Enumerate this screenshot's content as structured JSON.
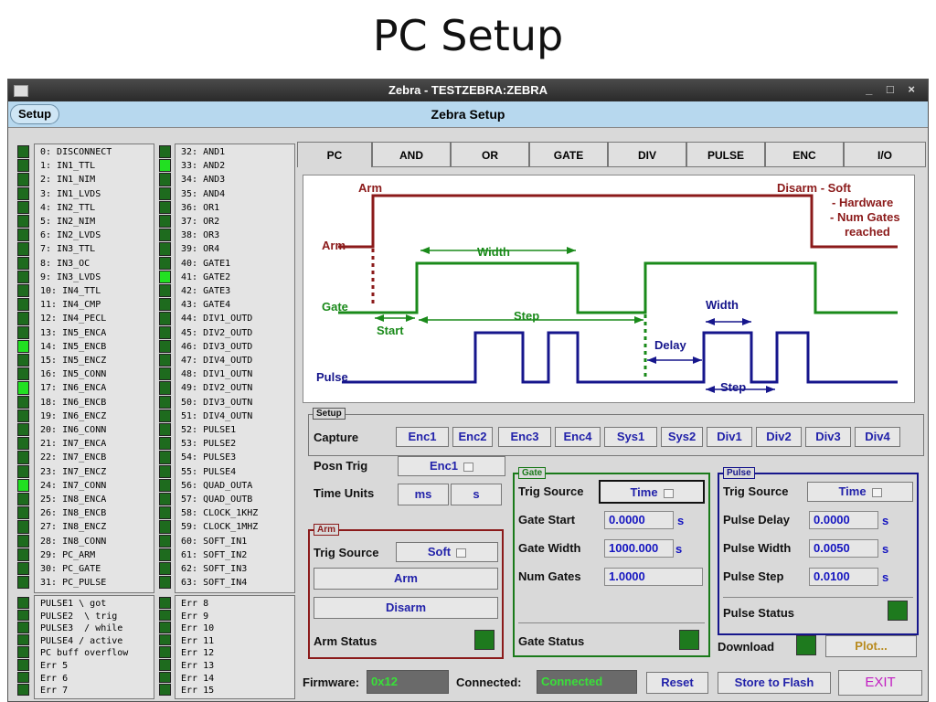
{
  "slide_title": "PC Setup",
  "window": {
    "title": "Zebra - TESTZEBRA:ZEBRA",
    "controls": "_ □ ×",
    "menu_setup": "Setup",
    "heading": "Zebra Setup"
  },
  "signals_col1": [
    {
      "label": "0: DISCONNECT",
      "on": false
    },
    {
      "label": "1: IN1_TTL",
      "on": false
    },
    {
      "label": "2: IN1_NIM",
      "on": false
    },
    {
      "label": "3: IN1_LVDS",
      "on": false
    },
    {
      "label": "4: IN2_TTL",
      "on": false
    },
    {
      "label": "5: IN2_NIM",
      "on": false
    },
    {
      "label": "6: IN2_LVDS",
      "on": false
    },
    {
      "label": "7: IN3_TTL",
      "on": false
    },
    {
      "label": "8: IN3_OC",
      "on": false
    },
    {
      "label": "9: IN3_LVDS",
      "on": false
    },
    {
      "label": "10: IN4_TTL",
      "on": false
    },
    {
      "label": "11: IN4_CMP",
      "on": false
    },
    {
      "label": "12: IN4_PECL",
      "on": false
    },
    {
      "label": "13: IN5_ENCA",
      "on": false
    },
    {
      "label": "14: IN5_ENCB",
      "on": true
    },
    {
      "label": "15: IN5_ENCZ",
      "on": false
    },
    {
      "label": "16: IN5_CONN",
      "on": false
    },
    {
      "label": "17: IN6_ENCA",
      "on": true
    },
    {
      "label": "18: IN6_ENCB",
      "on": false
    },
    {
      "label": "19: IN6_ENCZ",
      "on": false
    },
    {
      "label": "20: IN6_CONN",
      "on": false
    },
    {
      "label": "21: IN7_ENCA",
      "on": false
    },
    {
      "label": "22: IN7_ENCB",
      "on": false
    },
    {
      "label": "23: IN7_ENCZ",
      "on": false
    },
    {
      "label": "24: IN7_CONN",
      "on": true
    },
    {
      "label": "25: IN8_ENCA",
      "on": false
    },
    {
      "label": "26: IN8_ENCB",
      "on": false
    },
    {
      "label": "27: IN8_ENCZ",
      "on": false
    },
    {
      "label": "28: IN8_CONN",
      "on": false
    },
    {
      "label": "29: PC_ARM",
      "on": false
    },
    {
      "label": "30: PC_GATE",
      "on": false
    },
    {
      "label": "31: PC_PULSE",
      "on": false
    }
  ],
  "signals_col2": [
    {
      "label": "32: AND1",
      "on": false
    },
    {
      "label": "33: AND2",
      "on": true
    },
    {
      "label": "34: AND3",
      "on": false
    },
    {
      "label": "35: AND4",
      "on": false
    },
    {
      "label": "36: OR1",
      "on": false
    },
    {
      "label": "37: OR2",
      "on": false
    },
    {
      "label": "38: OR3",
      "on": false
    },
    {
      "label": "39: OR4",
      "on": false
    },
    {
      "label": "40: GATE1",
      "on": false
    },
    {
      "label": "41: GATE2",
      "on": true
    },
    {
      "label": "42: GATE3",
      "on": false
    },
    {
      "label": "43: GATE4",
      "on": false
    },
    {
      "label": "44: DIV1_OUTD",
      "on": false
    },
    {
      "label": "45: DIV2_OUTD",
      "on": false
    },
    {
      "label": "46: DIV3_OUTD",
      "on": false
    },
    {
      "label": "47: DIV4_OUTD",
      "on": false
    },
    {
      "label": "48: DIV1_OUTN",
      "on": false
    },
    {
      "label": "49: DIV2_OUTN",
      "on": false
    },
    {
      "label": "50: DIV3_OUTN",
      "on": false
    },
    {
      "label": "51: DIV4_OUTN",
      "on": false
    },
    {
      "label": "52: PULSE1",
      "on": false
    },
    {
      "label": "53: PULSE2",
      "on": false
    },
    {
      "label": "54: PULSE3",
      "on": false
    },
    {
      "label": "55: PULSE4",
      "on": false
    },
    {
      "label": "56: QUAD_OUTA",
      "on": false
    },
    {
      "label": "57: QUAD_OUTB",
      "on": false
    },
    {
      "label": "58: CLOCK_1KHZ",
      "on": false
    },
    {
      "label": "59: CLOCK_1MHZ",
      "on": false
    },
    {
      "label": "60: SOFT_IN1",
      "on": false
    },
    {
      "label": "61: SOFT_IN2",
      "on": false
    },
    {
      "label": "62: SOFT_IN3",
      "on": false
    },
    {
      "label": "63: SOFT_IN4",
      "on": false
    }
  ],
  "status_col1": [
    "PULSE1 \\ got",
    "PULSE2  \\ trig",
    "PULSE3  / while",
    "PULSE4 / active",
    "PC buff overflow",
    "Err 5",
    "Err 6",
    "Err 7"
  ],
  "status_col2": [
    "Err 8",
    "Err 9",
    "Err 10",
    "Err 11",
    "Err 12",
    "Err 13",
    "Err 14",
    "Err 15"
  ],
  "tabs": [
    "PC",
    "AND",
    "OR",
    "GATE",
    "DIV",
    "PULSE",
    "ENC",
    "I/O"
  ],
  "diagram": {
    "arm_top": "Arm",
    "arm_side": "Arm",
    "disarm": "Disarm - Soft",
    "hardware": "- Hardware",
    "num_gates": "- Num Gates",
    "reached": "reached",
    "width1": "Width",
    "gate": "Gate",
    "start": "Start",
    "step1": "Step",
    "width2": "Width",
    "delay": "Delay",
    "pulse": "Pulse",
    "step2": "Step",
    "colors": {
      "arm": "#8b1a1a",
      "gate": "#1a8a1a",
      "pulse": "#16168c"
    }
  },
  "setup": {
    "title": "Setup",
    "capture_label": "Capture",
    "capture_buttons": [
      "Enc1",
      "Enc2",
      "Enc3",
      "Enc4",
      "Sys1",
      "Sys2",
      "Div1",
      "Div2",
      "Div3",
      "Div4"
    ],
    "posn_trig_label": "Posn Trig",
    "posn_trig_value": "Enc1",
    "time_units_label": "Time Units",
    "time_units": [
      "ms",
      "s"
    ]
  },
  "arm": {
    "title": "Arm",
    "trig_source_label": "Trig Source",
    "trig_source_value": "Soft",
    "arm_button": "Arm",
    "disarm_button": "Disarm",
    "status_label": "Arm Status"
  },
  "gate": {
    "title": "Gate",
    "trig_source_label": "Trig Source",
    "trig_source_value": "Time",
    "start_label": "Gate Start",
    "start_value": "0.0000",
    "start_unit": "s",
    "width_label": "Gate Width",
    "width_value": "1000.000",
    "width_unit": "s",
    "num_label": "Num Gates",
    "num_value": "1.0000",
    "status_label": "Gate Status"
  },
  "pulse": {
    "title": "Pulse",
    "trig_source_label": "Trig Source",
    "trig_source_value": "Time",
    "delay_label": "Pulse Delay",
    "delay_value": "0.0000",
    "delay_unit": "s",
    "width_label": "Pulse Width",
    "width_value": "0.0050",
    "width_unit": "s",
    "step_label": "Pulse Step",
    "step_value": "0.0100",
    "step_unit": "s",
    "status_label": "Pulse Status",
    "download_label": "Download",
    "plot_button": "Plot..."
  },
  "footer": {
    "firmware_label": "Firmware:",
    "firmware_value": "0x12",
    "connected_label": "Connected:",
    "connected_value": "Connected",
    "reset": "Reset",
    "store": "Store to Flash",
    "exit": "EXIT"
  }
}
